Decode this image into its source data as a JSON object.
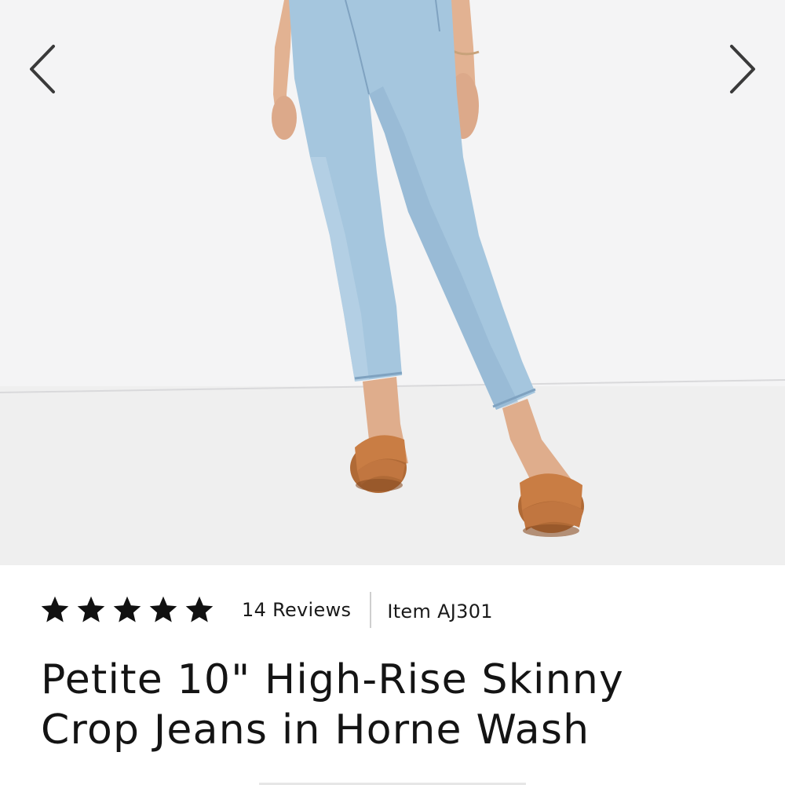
{
  "carousel": {
    "prev_icon": "chevron-left-icon",
    "next_icon": "chevron-right-icon",
    "image": "model wearing light-wash jeans and tan woven slide sandals",
    "colors": {
      "background": "#f3f3f4",
      "denim": "#9cc1da",
      "sandal": "#c0773f",
      "arrow": "#3a3a3a"
    }
  },
  "product": {
    "rating": 5,
    "rating_max": 5,
    "star_icon": "star-icon",
    "reviews_label": "14 Reviews",
    "item_label": "Item AJ301",
    "title_line1": "Petite 10\" High-Rise Skinny",
    "title_line2": "Crop Jeans in Horne Wash"
  }
}
